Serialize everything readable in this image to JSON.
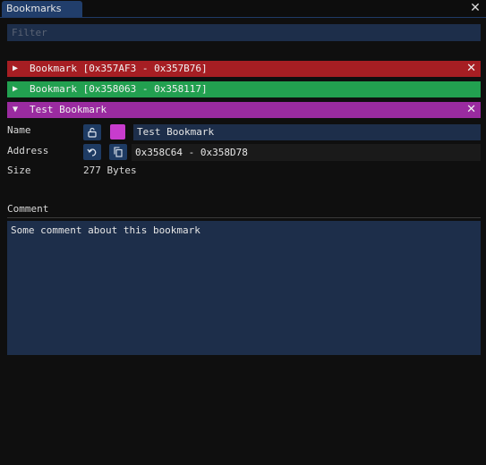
{
  "window": {
    "tab_label": "Bookmarks",
    "close_glyph": "✕"
  },
  "filter": {
    "placeholder": "Filter"
  },
  "bookmarks": [
    {
      "label": "Bookmark [0x357AF3 - 0x357B76]",
      "color": "#a61e23",
      "expanded": false,
      "arrow": "▶",
      "close_glyph": "✕"
    },
    {
      "label": "Bookmark [0x358063 - 0x358117]",
      "color": "#22a050",
      "expanded": false,
      "arrow": "▶",
      "close_glyph": ""
    },
    {
      "label": "Test Bookmark",
      "color": "#9a2ba0",
      "expanded": true,
      "arrow": "▼",
      "close_glyph": "✕"
    }
  ],
  "details": {
    "name_label": "Name",
    "name_value": "Test Bookmark",
    "swatch_color": "#c83ccd",
    "address_label": "Address",
    "address_value": "0x358C64 - 0x358D78",
    "size_label": "Size",
    "size_value": "277 Bytes",
    "comment_label": "Comment",
    "comment_value": "Some comment about this bookmark",
    "icons": {
      "lock": "unlock-icon",
      "jump": "jump-to-icon",
      "copy": "copy-icon"
    }
  }
}
